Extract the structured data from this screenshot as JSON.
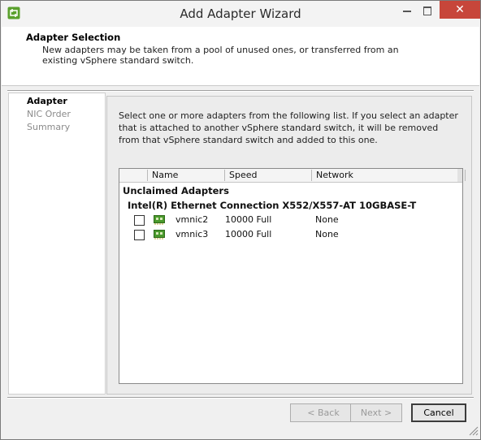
{
  "window": {
    "title": "Add Adapter Wizard",
    "close_glyph": "✕"
  },
  "header": {
    "title": "Adapter Selection",
    "description": "New adapters may be taken from a pool of unused ones, or transferred from an existing vSphere standard switch."
  },
  "steps": [
    "Adapter",
    "NIC Order",
    "Summary"
  ],
  "instructions": "Select one or more adapters from the following list. If you select an adapter that is attached to another vSphere standard switch, it will be removed from that vSphere standard switch and added to this one.",
  "list": {
    "columns": {
      "name": "Name",
      "speed": "Speed",
      "network": "Network"
    },
    "group": "Unclaimed Adapters",
    "subgroup": "Intel(R) Ethernet Connection X552/X557-AT 10GBASE-T",
    "rows": [
      {
        "name": "vmnic2",
        "speed": "10000 Full",
        "network": "None",
        "checked": false
      },
      {
        "name": "vmnic3",
        "speed": "10000 Full",
        "network": "None",
        "checked": false
      }
    ]
  },
  "buttons": {
    "back": "< Back",
    "next": "Next >",
    "cancel": "Cancel"
  },
  "icons": {
    "app": "vsphere-logo-icon",
    "nic": "network-adapter-icon"
  },
  "colors": {
    "close_button": "#c7463a",
    "nic_icon": "#4a9a2c"
  }
}
